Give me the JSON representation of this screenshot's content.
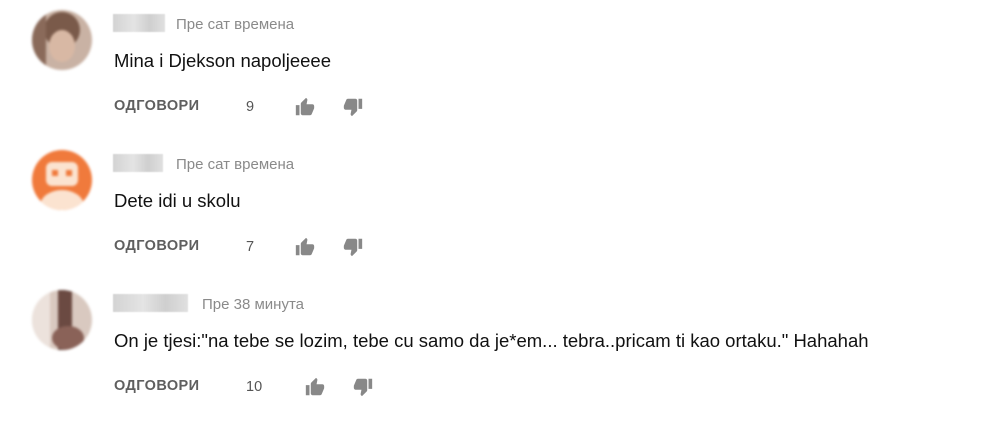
{
  "comments": [
    {
      "time": "Пре сат времена",
      "text": "Mina i Djekson napoljeeee",
      "reply_label": "ОДГОВОРИ",
      "likes": "9"
    },
    {
      "time": "Пре сат времена",
      "text": "Dete idi u skolu",
      "reply_label": "ОДГОВОРИ",
      "likes": "7"
    },
    {
      "time": "Пре 38 минута",
      "text": "On je tjesi:\"na tebe se lozim, tebe cu samo da je*em... tebra..pricam ti kao ortaku.\" Hahahah",
      "reply_label": "ОДГОВОРИ",
      "likes": "10"
    }
  ],
  "icons": {
    "like": "thumbs-up-icon",
    "dislike": "thumbs-down-icon"
  },
  "colors": {
    "icon": "#888888",
    "timestamp": "#8a8a8a",
    "avatar_orange": "#f07a3c"
  }
}
